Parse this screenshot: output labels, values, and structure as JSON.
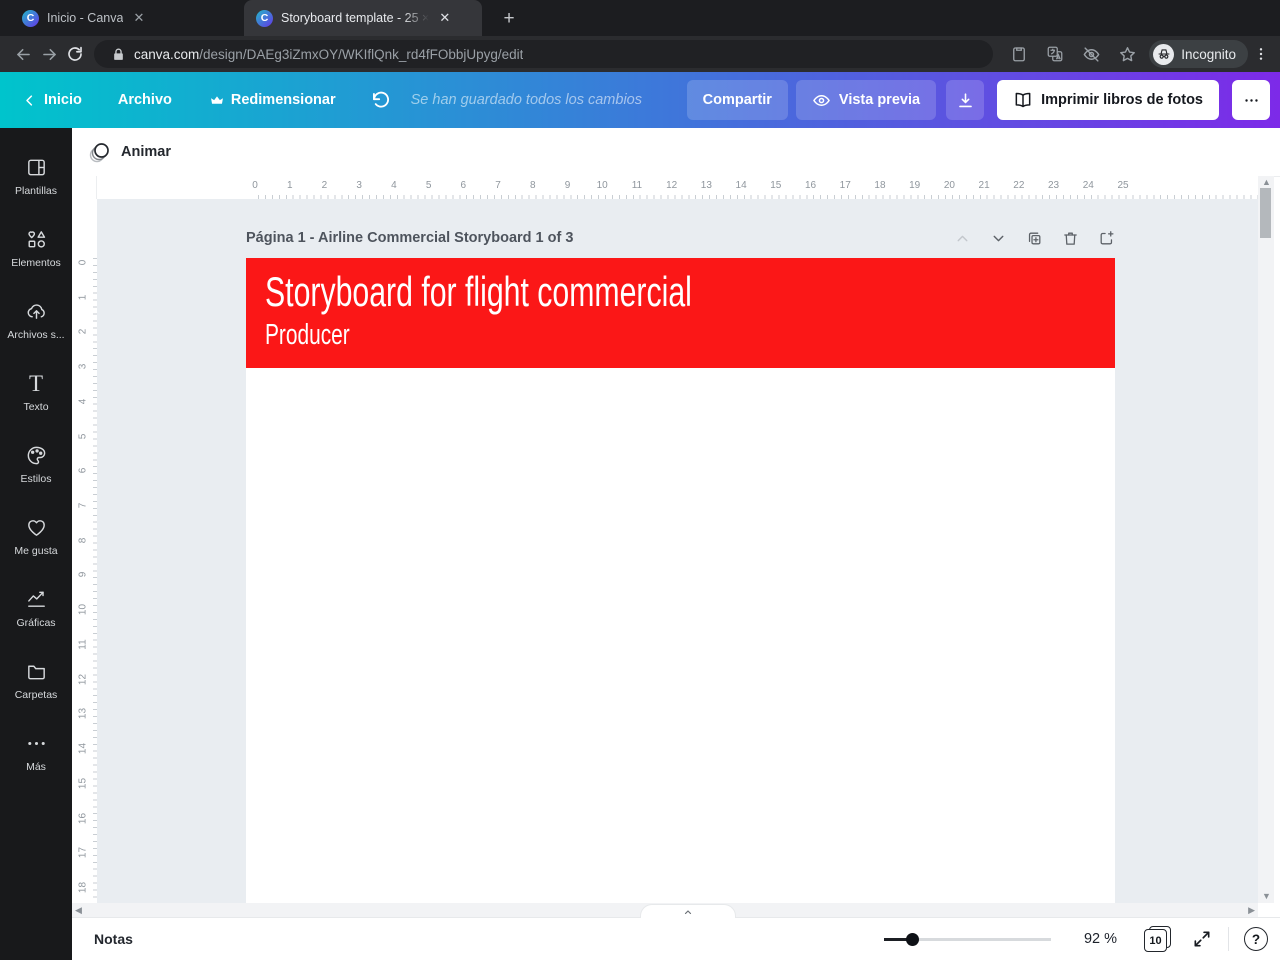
{
  "browser": {
    "tab_inactive": {
      "title": "Inicio - Canva",
      "favicon": "C",
      "close": "×"
    },
    "tab_active": {
      "title": "Storyboard template - 25 ×",
      "favicon": "C",
      "close": "×"
    },
    "new_tab_label": "+",
    "url": {
      "host": "canva.com",
      "path": "/design/DAEg3iZmxOY/WKIflQnk_rd4fFObbjUpyg/edit"
    },
    "profile_label": "Incognito"
  },
  "header": {
    "back_label": "Inicio",
    "file_label": "Archivo",
    "resize_label": "Redimensionar",
    "autosave_text": "Se han guardado todos los cambios",
    "share_label": "Compartir",
    "preview_label": "Vista previa",
    "print_label": "Imprimir libros de fotos"
  },
  "sidebar": {
    "items": [
      {
        "label": "Plantillas",
        "icon": "templates-icon"
      },
      {
        "label": "Elementos",
        "icon": "elements-icon"
      },
      {
        "label": "Archivos s...",
        "icon": "uploads-icon"
      },
      {
        "label": "Texto",
        "icon": "text-icon"
      },
      {
        "label": "Estilos",
        "icon": "styles-icon"
      },
      {
        "label": "Me gusta",
        "icon": "likes-icon"
      },
      {
        "label": "Gráficas",
        "icon": "charts-icon"
      },
      {
        "label": "Carpetas",
        "icon": "folders-icon"
      },
      {
        "label": "Más",
        "icon": "more-icon"
      }
    ]
  },
  "toolbar": {
    "animate_label": "Animar"
  },
  "canvas": {
    "page_label": "Página 1 - Airline Commercial Storyboard 1 of 3",
    "banner": {
      "title": "Storyboard for flight commercial",
      "subtitle": "Producer",
      "color": "#fb1717"
    },
    "ruler_h": [
      "0",
      "1",
      "2",
      "3",
      "4",
      "5",
      "6",
      "7",
      "8",
      "9",
      "10",
      "11",
      "12",
      "13",
      "14",
      "15",
      "16",
      "17",
      "18",
      "19",
      "20",
      "21",
      "22",
      "23",
      "24",
      "25"
    ],
    "ruler_v": [
      "0",
      "1",
      "2",
      "3",
      "4",
      "5",
      "6",
      "7",
      "8",
      "9",
      "10",
      "11",
      "12",
      "13",
      "14",
      "15",
      "16",
      "17",
      "18"
    ]
  },
  "footer": {
    "notes_label": "Notas",
    "zoom_value": "92 %",
    "page_count": "10"
  },
  "colors": {
    "banner_red": "#fb1717",
    "gradient_start": "#00c4cc",
    "gradient_end": "#7d2ae8",
    "canvas_bg": "#e9edf1"
  }
}
